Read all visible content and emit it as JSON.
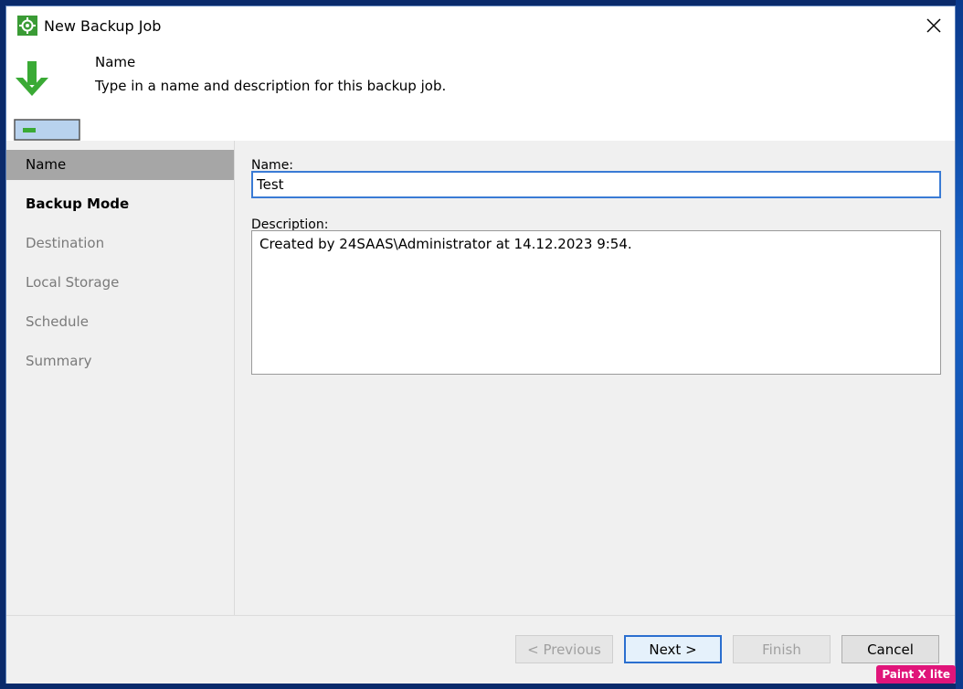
{
  "window": {
    "title": "New Backup Job",
    "close_icon": "close-icon"
  },
  "header": {
    "title": "Name",
    "subtitle": "Type in a name and description for this backup job."
  },
  "sidebar": {
    "items": [
      {
        "label": "Name",
        "state": "active"
      },
      {
        "label": "Backup Mode",
        "state": "bold"
      },
      {
        "label": "Destination",
        "state": "disabled"
      },
      {
        "label": "Local Storage",
        "state": "disabled"
      },
      {
        "label": "Schedule",
        "state": "disabled"
      },
      {
        "label": "Summary",
        "state": "disabled"
      }
    ]
  },
  "form": {
    "name_label": "Name:",
    "name_value": "Test",
    "description_label": "Description:",
    "description_value": "Created by 24SAAS\\Administrator at 14.12.2023 9:54."
  },
  "footer": {
    "previous_label": "< Previous",
    "next_label": "Next >",
    "finish_label": "Finish",
    "cancel_label": "Cancel"
  },
  "watermark": "Paint X lite",
  "colors": {
    "accent": "#3a7bd5",
    "icon_green": "#3a9b35",
    "active_nav": "#a6a6a6"
  }
}
